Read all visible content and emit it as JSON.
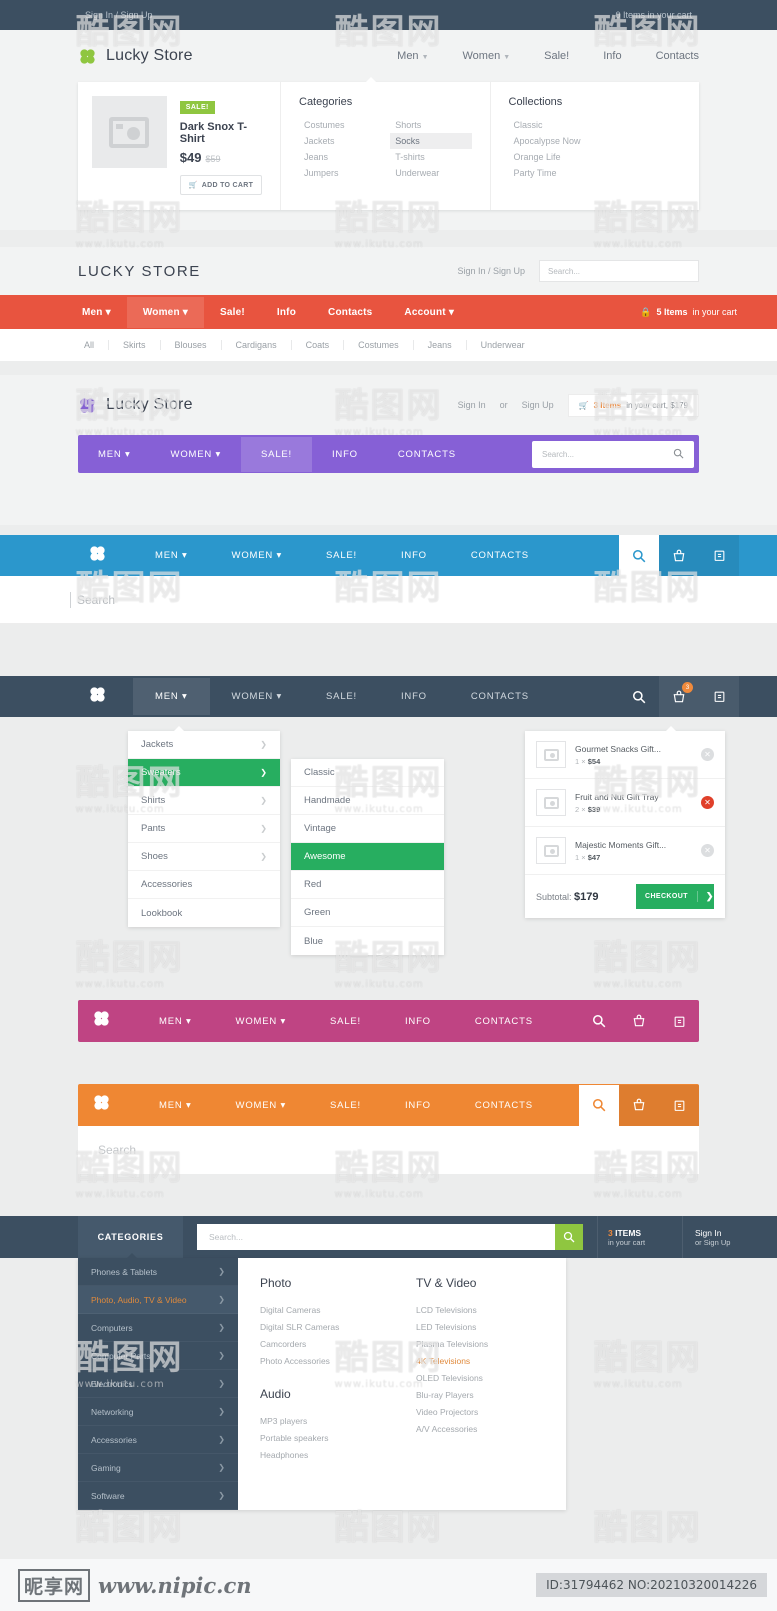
{
  "top_strip": {
    "auth": "Sign In / Sign Up",
    "cart": "0 Items in your cart"
  },
  "section1": {
    "brand": "Lucky Store",
    "nav": [
      {
        "label": "Men",
        "caret": true
      },
      {
        "label": "Women",
        "caret": true
      },
      {
        "label": "Sale!",
        "caret": false
      },
      {
        "label": "Info",
        "caret": false
      },
      {
        "label": "Contacts",
        "caret": false
      }
    ],
    "promo": {
      "badge": "SALE!",
      "name": "Dark Snox T-Shirt",
      "price": "$49",
      "old_price": "$59",
      "add_to_cart": "ADD TO CART"
    },
    "categories_title": "Categories",
    "categories_col1": [
      "Costumes",
      "Jackets",
      "Jeans",
      "Jumpers"
    ],
    "categories_col2": [
      "Shorts",
      "Socks",
      "T-shirts",
      "Underwear"
    ],
    "categories_highlight": "Socks",
    "collections_title": "Collections",
    "collections": [
      "Classic",
      "Apocalypse Now",
      "Orange Life",
      "Party Time"
    ]
  },
  "section2": {
    "title": "LUCKY STORE",
    "auth": "Sign In / Sign Up",
    "search_placeholder": "Search...",
    "nav": [
      {
        "label": "Men",
        "caret": true,
        "active": false
      },
      {
        "label": "Women",
        "caret": true,
        "active": true
      },
      {
        "label": "Sale!",
        "caret": false,
        "active": false
      },
      {
        "label": "Info",
        "caret": false,
        "active": false
      },
      {
        "label": "Contacts",
        "caret": false,
        "active": false
      },
      {
        "label": "Account",
        "caret": true,
        "active": false
      }
    ],
    "cart_count": "5 Items",
    "cart_suffix": "in your cart",
    "subnav": [
      "All",
      "Skirts",
      "Blouses",
      "Cardigans",
      "Coats",
      "Costumes",
      "Jeans",
      "Underwear"
    ]
  },
  "section3": {
    "brand": "Lucky Store",
    "sign_in": "Sign In",
    "sep": "or",
    "sign_up": "Sign Up",
    "cart_count": "3 Items",
    "cart_suffix": "in your cart, $179",
    "nav": [
      {
        "label": "MEN",
        "caret": true,
        "active": false
      },
      {
        "label": "WOMEN",
        "caret": true,
        "active": false
      },
      {
        "label": "SALE!",
        "caret": false,
        "active": true
      },
      {
        "label": "INFO",
        "caret": false,
        "active": false
      },
      {
        "label": "CONTACTS",
        "caret": false,
        "active": false
      }
    ],
    "search_placeholder": "Search..."
  },
  "section4": {
    "nav": [
      {
        "label": "MEN",
        "caret": true,
        "active": false
      },
      {
        "label": "WOMEN",
        "caret": true,
        "active": false
      },
      {
        "label": "SALE!",
        "caret": false,
        "active": false
      },
      {
        "label": "INFO",
        "caret": false,
        "active": false
      },
      {
        "label": "CONTACTS",
        "caret": false,
        "active": false
      }
    ],
    "search_placeholder": "Search"
  },
  "section5": {
    "nav": [
      {
        "label": "MEN",
        "caret": true,
        "active": true
      },
      {
        "label": "WOMEN",
        "caret": true,
        "active": false
      },
      {
        "label": "SALE!",
        "caret": false,
        "active": false
      },
      {
        "label": "INFO",
        "caret": false,
        "active": false
      },
      {
        "label": "CONTACTS",
        "caret": false,
        "active": false
      }
    ],
    "cart_badge": "3",
    "dropdown1": [
      {
        "label": "Jackets",
        "arrow": true,
        "active": false
      },
      {
        "label": "Sweaters",
        "arrow": true,
        "active": true
      },
      {
        "label": "Shirts",
        "arrow": true,
        "active": false
      },
      {
        "label": "Pants",
        "arrow": true,
        "active": false
      },
      {
        "label": "Shoes",
        "arrow": true,
        "active": false
      },
      {
        "label": "Accessories",
        "arrow": false,
        "active": false
      },
      {
        "label": "Lookbook",
        "arrow": false,
        "active": false
      }
    ],
    "dropdown2": [
      {
        "label": "Classic",
        "active": false
      },
      {
        "label": "Handmade",
        "active": false
      },
      {
        "label": "Vintage",
        "active": false
      },
      {
        "label": "Awesome",
        "active": true
      },
      {
        "label": "Red",
        "active": false
      },
      {
        "label": "Green",
        "active": false
      },
      {
        "label": "Blue",
        "active": false
      }
    ],
    "cart_items": [
      {
        "name": "Gourmet Snacks Gift...",
        "qty": "1",
        "x": "×",
        "price": "$54",
        "remove_active": false
      },
      {
        "name": "Fruit and Nut Gift Tray",
        "qty": "2",
        "x": "×",
        "price": "$39",
        "remove_active": true
      },
      {
        "name": "Majestic Moments Gift...",
        "qty": "1",
        "x": "×",
        "price": "$47",
        "remove_active": false
      }
    ],
    "subtotal_label": "Subtotal:",
    "subtotal_value": "$179",
    "checkout_label": "CHECKOUT"
  },
  "section6": {
    "nav": [
      {
        "label": "MEN",
        "caret": true,
        "active": false
      },
      {
        "label": "WOMEN",
        "caret": true,
        "active": false
      },
      {
        "label": "SALE!",
        "caret": false,
        "active": false
      },
      {
        "label": "INFO",
        "caret": false,
        "active": false
      },
      {
        "label": "CONTACTS",
        "caret": false,
        "active": false
      }
    ]
  },
  "section7": {
    "nav": [
      {
        "label": "MEN",
        "caret": true,
        "active": false
      },
      {
        "label": "WOMEN",
        "caret": true,
        "active": false
      },
      {
        "label": "SALE!",
        "caret": false,
        "active": false
      },
      {
        "label": "INFO",
        "caret": false,
        "active": false
      },
      {
        "label": "CONTACTS",
        "caret": false,
        "active": false
      }
    ],
    "search_placeholder": "Search"
  },
  "section8": {
    "categories_button": "CATEGORIES",
    "search_placeholder": "Search...",
    "cart_count": "3",
    "cart_items_label": "ITEMS",
    "cart_sub": "in your cart",
    "auth_main": "Sign In",
    "auth_sub": "or Sign Up",
    "sidebar": [
      {
        "label": "Phones & Tablets",
        "active": false
      },
      {
        "label": "Photo, Audio, TV & Video",
        "active": true
      },
      {
        "label": "Computers",
        "active": false
      },
      {
        "label": "Computer Parts",
        "active": false
      },
      {
        "label": "Electronics",
        "active": false
      },
      {
        "label": "Networking",
        "active": false
      },
      {
        "label": "Accessories",
        "active": false
      },
      {
        "label": "Gaming",
        "active": false
      },
      {
        "label": "Software",
        "active": false
      }
    ],
    "col1_title": "Photo",
    "col1_items": [
      "Digital Cameras",
      "Digital SLR Cameras",
      "Camcorders",
      "Photo Accessories"
    ],
    "col1b_title": "Audio",
    "col1b_items": [
      "MP3 players",
      "Portable speakers",
      "Headphones"
    ],
    "col2_title": "TV & Video",
    "col2_items": [
      "LCD Televisions",
      "LED Televisions",
      "Plasma Televisions",
      "4K Televisions",
      "OLED Televisions",
      "Blu-ray Players",
      "Video Projectors",
      "A/V Accessories"
    ],
    "col2_highlight": "4K Televisions"
  },
  "watermark": {
    "mark": "酷图网",
    "site": "www.ikutu.com",
    "footer_cn": "昵享网",
    "footer_url": "www.nipic.cn",
    "footer_id": "ID:31794462 NO:20210320014226"
  },
  "colors": {
    "red": "#e8543f",
    "purple": "#8660d6",
    "blue": "#2b97cc",
    "dark": "#3c4f61",
    "pink": "#bf4483",
    "orange": "#ef8733",
    "green": "#27ae60",
    "lime": "#8fc640",
    "accent_orange": "#f08a3c"
  }
}
